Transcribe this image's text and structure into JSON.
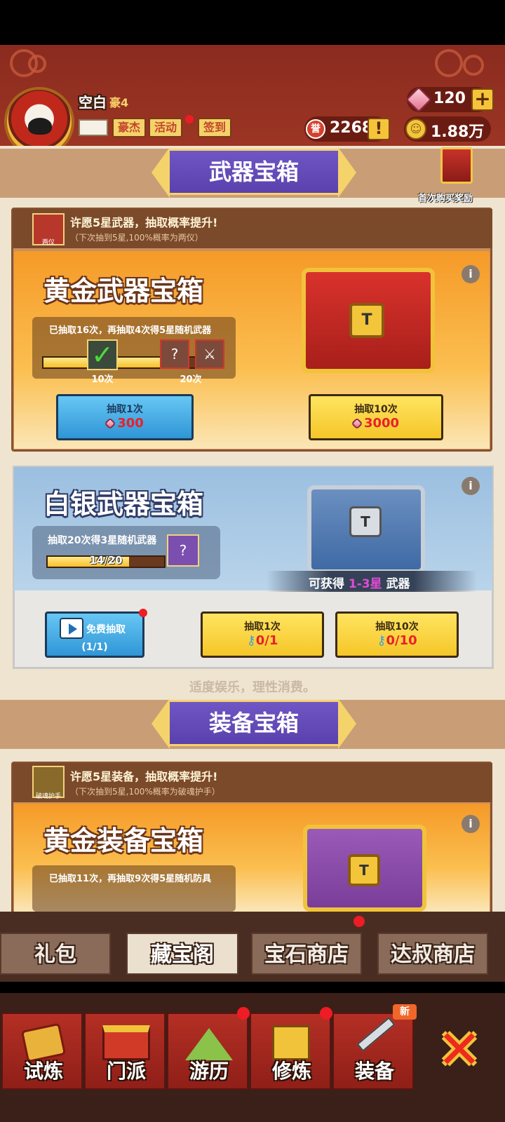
{
  "player": {
    "name": "空白",
    "level": "豪4",
    "buttons": [
      "豪杰",
      "活动",
      "签到"
    ]
  },
  "resources": {
    "gems": "120",
    "tickets": "2268",
    "coins": "1.88万",
    "ticket_icon_char": "誉",
    "coin_icon_char": "☺",
    "alert_char": "!"
  },
  "first_purchase_label": "首次购买奖励",
  "weapon_section": {
    "title": "武器宝箱",
    "wish_title": "许愿5星武器，抽取概率提升!",
    "wish_sub": "（下次抽到5星,100%概率为两仪）",
    "wish_item_label": "两仪",
    "gold": {
      "title": "黄金武器宝箱",
      "progress_text": "已抽取16次，再抽取4次得5星随机武器",
      "progress": 0.8,
      "milestones": [
        "10次",
        "20次"
      ],
      "btn1_label": "抽取1次",
      "btn1_price": "300",
      "btn2_label": "抽取10次",
      "btn2_price": "3000"
    },
    "silver": {
      "title": "白银武器宝箱",
      "progress_text": "抽取20次得3星随机武器",
      "progress_value": "14/20",
      "progress": 0.7,
      "gain_prefix": "可获得",
      "gain_stars": "1-3星",
      "gain_suffix": "武器",
      "free_label": "免费抽取",
      "free_count": "(1/1)",
      "btn1_label": "抽取1次",
      "btn1_price": "0/1",
      "btn2_label": "抽取10次",
      "btn2_price": "0/10"
    }
  },
  "notice": "适度娱乐，理性消费。",
  "equip_section": {
    "title": "装备宝箱",
    "wish_title": "许愿5星装备，抽取概率提升!",
    "wish_sub": "（下次抽到5星,100%概率为破魂护手）",
    "wish_item_label": "破魂护手",
    "gold": {
      "title": "黄金装备宝箱",
      "progress_text": "已抽取11次，再抽取9次得5星随机防具"
    }
  },
  "tabs": [
    "礼包",
    "藏宝阁",
    "宝石商店",
    "达叔商店"
  ],
  "active_tab": "藏宝阁",
  "nav": [
    "试炼",
    "门派",
    "游历",
    "修炼",
    "装备"
  ],
  "nav_new_badge": "新",
  "colors": {
    "header": "#8a2b1f",
    "banner": "#5f46b3",
    "gold_card": "#f59a28",
    "silver_card": "#a6c8e6",
    "price_red": "#e8212a"
  }
}
